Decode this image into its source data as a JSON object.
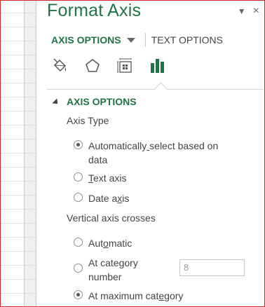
{
  "pane": {
    "title": "Format Axis",
    "controls": {
      "dropdown_glyph": "▼",
      "close_glyph": "×"
    }
  },
  "tabs": {
    "active": "AXIS OPTIONS",
    "inactive": "TEXT OPTIONS"
  },
  "icon_tabs": [
    "fill-line-icon",
    "effects-pentagon-icon",
    "size-properties-icon",
    "axis-options-bars-icon"
  ],
  "colors": {
    "accent": "#217346",
    "frame_border": "#d9262b"
  },
  "section": {
    "title": "AXIS OPTIONS"
  },
  "axis_type": {
    "label": "Axis Type",
    "options": [
      {
        "pre": "Automatically",
        "u": " ",
        "post": "select based on",
        "line2": "data",
        "checked": true
      },
      {
        "pre": "",
        "u": "T",
        "post": "ext axis",
        "checked": false
      },
      {
        "pre": "Date a",
        "u": "x",
        "post": "is",
        "checked": false
      }
    ]
  },
  "crosses": {
    "label": "Vertical axis crosses",
    "options": [
      {
        "pre": "Aut",
        "u": "o",
        "post": "matic",
        "checked": false
      },
      {
        "pre": "At cate",
        "u": "g",
        "post": "ory",
        "line2": "number",
        "checked": false
      },
      {
        "pre": "At maximum cat",
        "u": "e",
        "post": "gory",
        "checked": true
      }
    ],
    "category_number_value": "8"
  }
}
